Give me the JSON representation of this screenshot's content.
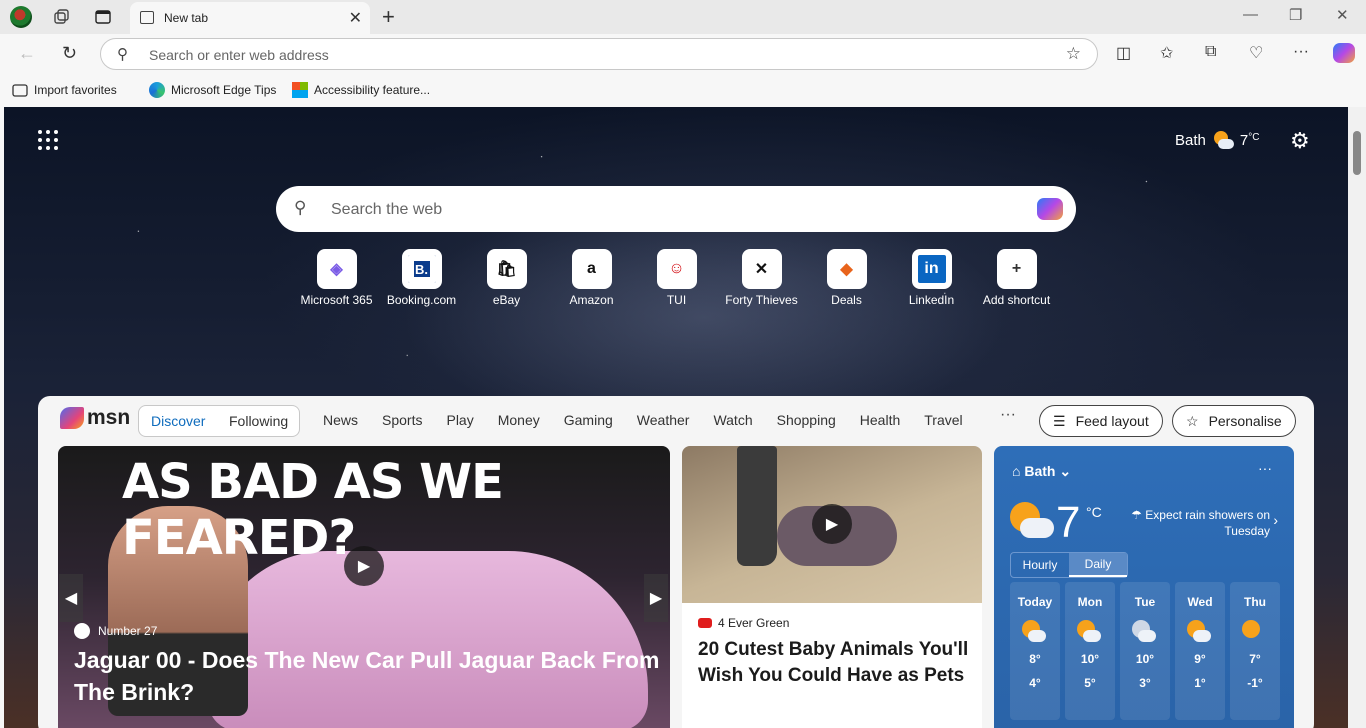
{
  "browser": {
    "tab_title": "New tab",
    "address_placeholder": "Search or enter web address",
    "favorites": [
      "Import favorites",
      "Microsoft Edge Tips",
      "Accessibility feature..."
    ]
  },
  "header": {
    "location": "Bath",
    "temperature": "7",
    "unit": "°C"
  },
  "search": {
    "placeholder": "Search the web"
  },
  "shortcuts": [
    {
      "label": "Microsoft 365",
      "glyph": "◈"
    },
    {
      "label": "Booking.com",
      "glyph": "B."
    },
    {
      "label": "eBay",
      "glyph": "🛍"
    },
    {
      "label": "Amazon",
      "glyph": "a"
    },
    {
      "label": "TUI",
      "glyph": "☺"
    },
    {
      "label": "Forty Thieves",
      "glyph": "✕"
    },
    {
      "label": "Deals",
      "glyph": "◆"
    },
    {
      "label": "LinkedIn",
      "glyph": "in"
    },
    {
      "label": "Add shortcut",
      "glyph": "+"
    }
  ],
  "feed": {
    "logo": "msn",
    "tabs": [
      "Discover",
      "Following"
    ],
    "categories": [
      "News",
      "Sports",
      "Play",
      "Money",
      "Gaming",
      "Weather",
      "Watch",
      "Shopping",
      "Health",
      "Travel"
    ],
    "more": "···",
    "feed_layout": "Feed layout",
    "personalise": "Personalise"
  },
  "main_story": {
    "image_text": "AS BAD AS WE FEARED?",
    "source": "Number 27",
    "title": "Jaguar 00 - Does The New Car Pull Jaguar Back From The Brink?"
  },
  "side_story": {
    "source": "4 Ever Green",
    "title": "20 Cutest Baby Animals You'll Wish You Could Have as Pets"
  },
  "weather": {
    "location": "Bath",
    "temperature": "7",
    "unit": "°C",
    "forecast_note": "Expect rain showers on Tuesday",
    "toggle": [
      "Hourly",
      "Daily"
    ],
    "days": [
      {
        "name": "Today",
        "high": "8°",
        "low": "4°",
        "icon": "partly-cloudy"
      },
      {
        "name": "Mon",
        "high": "10°",
        "low": "5°",
        "icon": "partly-cloudy"
      },
      {
        "name": "Tue",
        "high": "10°",
        "low": "3°",
        "icon": "rain"
      },
      {
        "name": "Wed",
        "high": "9°",
        "low": "1°",
        "icon": "partly-cloudy"
      },
      {
        "name": "Thu",
        "high": "7°",
        "low": "-1°",
        "icon": "sunny"
      }
    ]
  }
}
